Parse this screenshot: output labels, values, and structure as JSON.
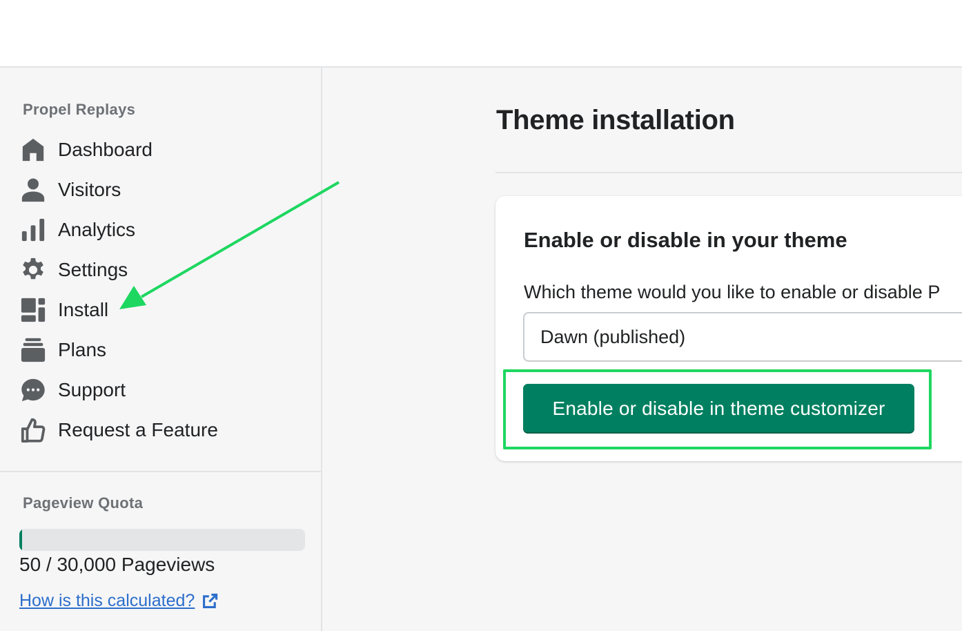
{
  "sidebar": {
    "app_name": "Propel Replays",
    "items": [
      {
        "label": "Dashboard",
        "icon": "home-icon"
      },
      {
        "label": "Visitors",
        "icon": "person-icon"
      },
      {
        "label": "Analytics",
        "icon": "bar-chart-icon"
      },
      {
        "label": "Settings",
        "icon": "gear-icon"
      },
      {
        "label": "Install",
        "icon": "blocks-icon"
      },
      {
        "label": "Plans",
        "icon": "stack-icon"
      },
      {
        "label": "Support",
        "icon": "chat-icon"
      },
      {
        "label": "Request a Feature",
        "icon": "thumbs-up-icon"
      }
    ]
  },
  "quota": {
    "heading": "Pageview Quota",
    "used": 50,
    "total": 30000,
    "text": "50 / 30,000 Pageviews",
    "link_label": "How is this calculated?"
  },
  "main": {
    "title": "Theme installation",
    "card": {
      "title": "Enable or disable in your theme",
      "question": "Which theme would you like to enable or disable P",
      "selected_theme": "Dawn (published)",
      "button_label": "Enable or disable in theme customizer"
    }
  },
  "colors": {
    "primary": "#008060",
    "annotation": "#1ed760",
    "link": "#2c6ecb"
  }
}
